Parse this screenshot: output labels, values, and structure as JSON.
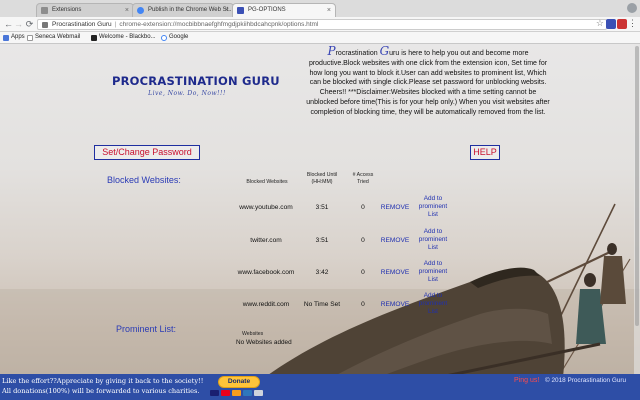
{
  "browser": {
    "tabs": [
      {
        "label": "Extensions",
        "color": "#8d8d8d"
      },
      {
        "label": "Publish in the Chrome Web St...",
        "color": "#4285f4"
      },
      {
        "label": "PG-OPTIONS",
        "color": "#3b50b5"
      }
    ],
    "address": {
      "title": "Procrastination Guru",
      "url": "chrome-extension://mocbibbnaefghfmgdjpkiihbdcahcpnk/options.html"
    },
    "bookmarks": [
      {
        "label": "Apps",
        "icon": "apps-grid-icon"
      },
      {
        "label": "Seneca Webmail",
        "icon": "document-icon"
      },
      {
        "label": "Welcome - Blackbo...",
        "icon": "blackboard-icon"
      },
      {
        "label": "Google",
        "icon": "google-icon"
      }
    ]
  },
  "header": {
    "logo_title": "PROCRASTINATION GURU",
    "logo_tagline": "Live, Now. Do, Now!!!",
    "intro_first_letter": "P",
    "intro_lead": "rocrastination ",
    "intro_second_letter": "G",
    "intro_rest": "uru is here to help you out and become more productive.Block websites with one click from the extension icon, Set time for how long you want to block it.User can add websites to prominent list, Which can be blocked with single click.Please set password for unblocking websits. Cheers!! ***Disclaimer:Websites blocked with a time setting cannot be unblocked before time(This is for your help only.) When you visit websites after completion of blocking time, they will be automatically removed from the list."
  },
  "buttons": {
    "set_password": "Set/Change Password",
    "help": "HELP"
  },
  "blocked": {
    "title": "Blocked Websites:",
    "headers": {
      "site": "Blocked Websites",
      "until": "Blocked Until (HH:MM)",
      "tries": "# Access Tried"
    },
    "remove_label": "REMOVE",
    "add_label": "Add to prominent List",
    "rows": [
      {
        "site": "www.youtube.com",
        "until": "3:51",
        "tries": "0"
      },
      {
        "site": "twitter.com",
        "until": "3:51",
        "tries": "0"
      },
      {
        "site": "www.facebook.com",
        "until": "3:42",
        "tries": "0"
      },
      {
        "site": "www.reddit.com",
        "until": "No Time Set",
        "tries": "0"
      }
    ]
  },
  "prominent": {
    "title": "Prominent List:",
    "header": "Websites",
    "empty": "No Websites added"
  },
  "footer": {
    "line1": "Like the effort??Appreciate by giving it back to the society!!",
    "line2": "All donations(100%) will be forwarded to various charities.",
    "donate_label": "Donate",
    "ping_label": "Ping us!",
    "copyright": "© 2018 Procrastination Guru"
  },
  "colors": {
    "brand_blue": "#1e2a8c",
    "accent_red": "#c8102e",
    "link_blue": "#1f2fb0",
    "footer_bg": "#2e4ea6",
    "donate_yellow": "#ffc43a"
  }
}
